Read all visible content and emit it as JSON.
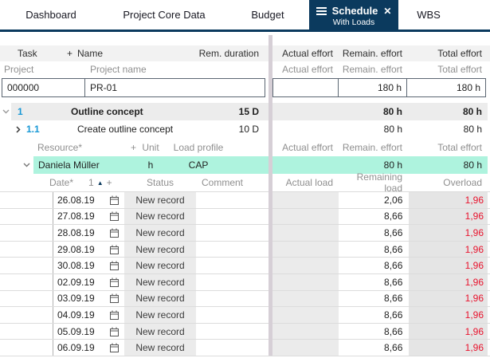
{
  "tab_bar": {
    "tabs": [
      {
        "label": "Dashboard"
      },
      {
        "label": "Project Core Data"
      },
      {
        "label": "Budget"
      },
      {
        "label": "Schedule",
        "sublabel": "With Loads",
        "active": true,
        "close_icon": "✕"
      },
      {
        "label": "WBS"
      }
    ]
  },
  "task_grid": {
    "header": {
      "task": "Task",
      "plus": "+",
      "name": "Name",
      "rem_duration": "Rem. duration",
      "actual_effort": "Actual effort",
      "remain_effort": "Remain. effort",
      "total_effort": "Total effort"
    },
    "subheader": {
      "project": "Project",
      "project_name": "Project name",
      "actual_effort": "Actual effort",
      "remain_effort": "Remain. effort",
      "total_effort": "Total effort"
    },
    "project_row": {
      "number": "000000",
      "name": "PR-01",
      "actual_effort": "",
      "remain_effort": "180 h",
      "total_effort": "180 h"
    },
    "task_rows": [
      {
        "wbs": "1",
        "name": "Outline concept",
        "rem_duration": "15 D",
        "remain_effort": "80 h",
        "total_effort": "80 h"
      },
      {
        "wbs": "1.1",
        "name": "Create outline concept",
        "rem_duration": "10 D",
        "remain_effort": "80 h",
        "total_effort": "80 h"
      }
    ]
  },
  "resource_grid": {
    "header": {
      "resource": "Resource*",
      "plus": "+",
      "unit": "Unit",
      "load_profile": "Load profile",
      "actual_effort": "Actual effort",
      "remain_effort": "Remain. effort",
      "total_effort": "Total effort"
    },
    "resource_row": {
      "name": "Daniela Müller",
      "unit": "h",
      "load_profile": "CAP",
      "remain_effort": "80 h",
      "total_effort": "80 h"
    },
    "load_header": {
      "date": "Date*",
      "sort_number": "1",
      "plus": "+",
      "status": "Status",
      "comment": "Comment",
      "actual_load": "Actual load",
      "remaining_load": "Remaining load",
      "overload": "Overload"
    },
    "load_rows": [
      {
        "date": "26.08.19",
        "status": "New record",
        "comment": "",
        "actual_load": "",
        "remaining_load": "2,06",
        "overload": "1,96"
      },
      {
        "date": "27.08.19",
        "status": "New record",
        "comment": "",
        "actual_load": "",
        "remaining_load": "8,66",
        "overload": "1,96"
      },
      {
        "date": "28.08.19",
        "status": "New record",
        "comment": "",
        "actual_load": "",
        "remaining_load": "8,66",
        "overload": "1,96"
      },
      {
        "date": "29.08.19",
        "status": "New record",
        "comment": "",
        "actual_load": "",
        "remaining_load": "8,66",
        "overload": "1,96"
      },
      {
        "date": "30.08.19",
        "status": "New record",
        "comment": "",
        "actual_load": "",
        "remaining_load": "8,66",
        "overload": "1,96"
      },
      {
        "date": "02.09.19",
        "status": "New record",
        "comment": "",
        "actual_load": "",
        "remaining_load": "8,66",
        "overload": "1,96"
      },
      {
        "date": "03.09.19",
        "status": "New record",
        "comment": "",
        "actual_load": "",
        "remaining_load": "8,66",
        "overload": "1,96"
      },
      {
        "date": "04.09.19",
        "status": "New record",
        "comment": "",
        "actual_load": "",
        "remaining_load": "8,66",
        "overload": "1,96"
      },
      {
        "date": "05.09.19",
        "status": "New record",
        "comment": "",
        "actual_load": "",
        "remaining_load": "8,66",
        "overload": "1,96"
      },
      {
        "date": "06.09.19",
        "status": "New record",
        "comment": "",
        "actual_load": "",
        "remaining_load": "8,66",
        "overload": "1,96"
      }
    ]
  },
  "colors": {
    "accent_navy": "#0b3a5e",
    "selected_teal": "#aef3de",
    "overload_red": "#e8132d",
    "wbs_blue": "#1898d6"
  }
}
